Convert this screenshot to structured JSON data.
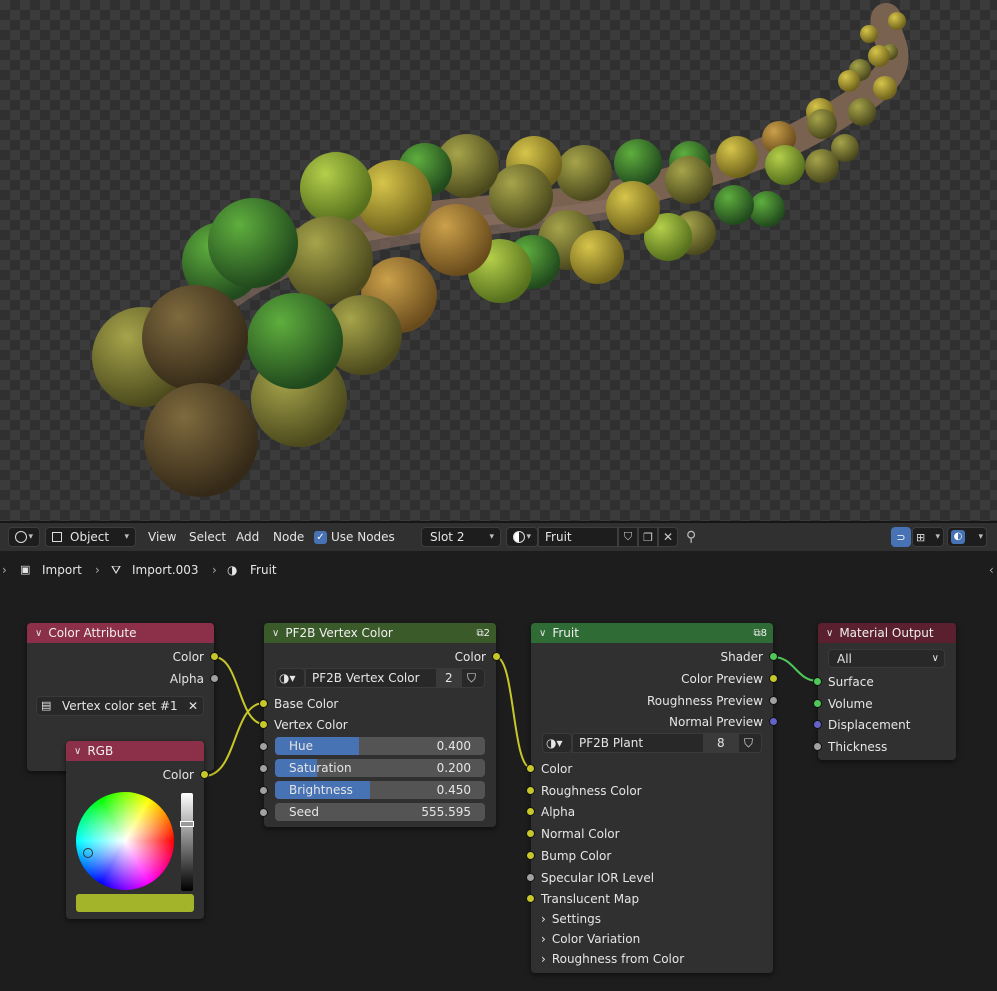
{
  "header": {
    "editor_type_icon": "node-editor-icon",
    "object_mode": "Object",
    "menus": [
      "View",
      "Select",
      "Add",
      "Node"
    ],
    "use_nodes_label": "Use Nodes",
    "use_nodes_checked": true,
    "slot": "Slot 2",
    "material_name": "Fruit"
  },
  "breadcrumb": {
    "items": [
      "Import",
      "Import.003",
      "Fruit"
    ]
  },
  "nodes": {
    "color_attribute": {
      "title": "Color Attribute",
      "header_color": "#8c2f48",
      "outputs": [
        "Color",
        "Alpha"
      ],
      "layer": "Vertex color set #1"
    },
    "rgb": {
      "title": "RGB",
      "header_color": "#8c2f48",
      "output": "Color",
      "swatch_color": "#a3b42a"
    },
    "vertex_color": {
      "title": "PF2B Vertex Color",
      "header_color": "#3b5a2a",
      "users_badge": "2",
      "output": "Color",
      "group_name": "PF2B Vertex Color",
      "group_users": "2",
      "inputs": [
        "Base Color",
        "Vertex Color"
      ],
      "fields": [
        {
          "label": "Hue",
          "value": "0.400",
          "fraction": 0.4
        },
        {
          "label": "Saturation",
          "value": "0.200",
          "fraction": 0.2
        },
        {
          "label": "Brightness",
          "value": "0.450",
          "fraction": 0.45
        },
        {
          "label": "Seed",
          "value": "555.595",
          "fraction": 0
        }
      ]
    },
    "fruit": {
      "title": "Fruit",
      "header_color": "#2e6b35",
      "users_badge": "8",
      "outputs": [
        "Shader",
        "Color Preview",
        "Roughness Preview",
        "Normal Preview"
      ],
      "group_name": "PF2B Plant",
      "group_users": "8",
      "inputs": [
        "Color",
        "Roughness Color",
        "Alpha",
        "Normal Color",
        "Bump Color",
        "Specular IOR Level",
        "Translucent Map"
      ],
      "panels": [
        "Settings",
        "Color Variation",
        "Roughness from Color"
      ]
    },
    "material_output": {
      "title": "Material Output",
      "header_color": "#5a2030",
      "target": "All",
      "inputs": [
        "Surface",
        "Volume",
        "Displacement",
        "Thickness"
      ]
    }
  }
}
